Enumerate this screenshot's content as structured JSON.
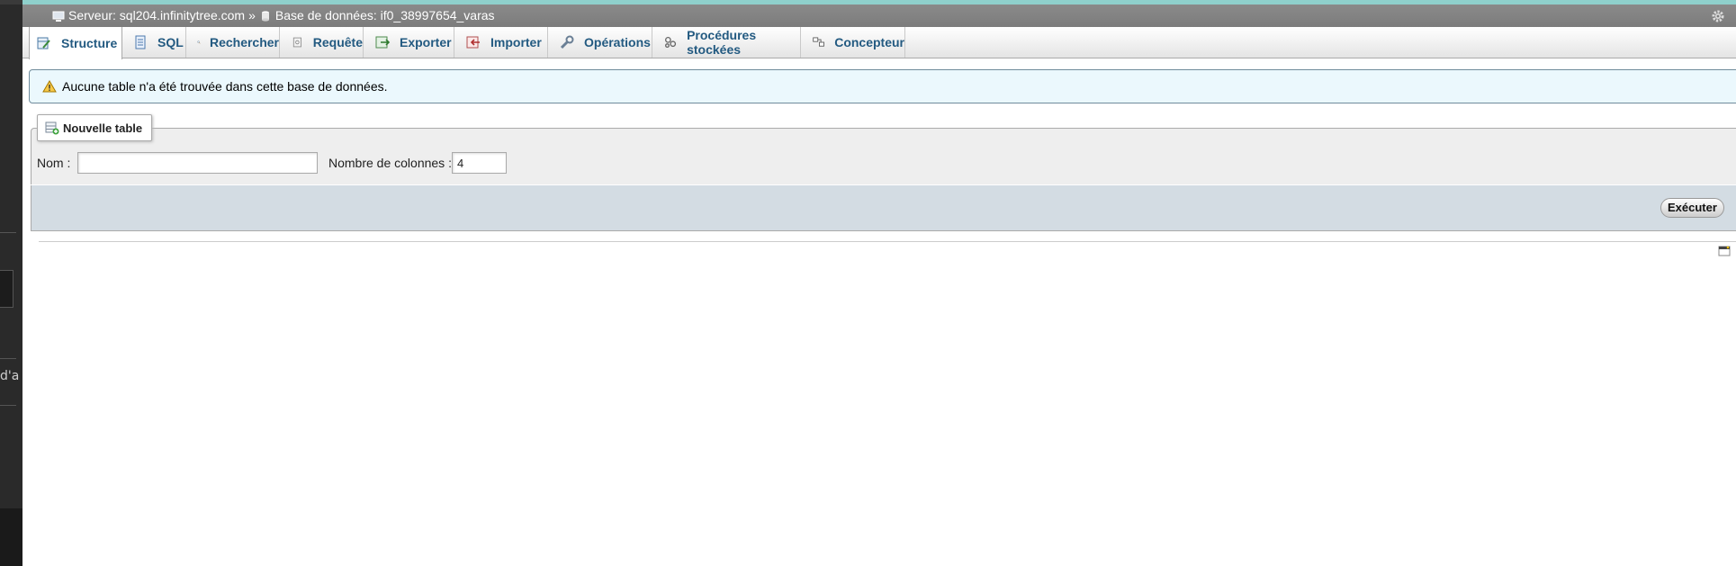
{
  "breadcrumb": {
    "server_label": "Serveur: sql204.infinitytree.com",
    "separator": "»",
    "database_label": "Base de données: if0_38997654_varas"
  },
  "tabs": [
    {
      "label": "Structure",
      "icon": "structure-icon",
      "active": true
    },
    {
      "label": "SQL",
      "icon": "sql-icon"
    },
    {
      "label": "Rechercher",
      "icon": "search-icon"
    },
    {
      "label": "Requête",
      "icon": "query-icon"
    },
    {
      "label": "Exporter",
      "icon": "export-icon"
    },
    {
      "label": "Importer",
      "icon": "import-icon"
    },
    {
      "label": "Opérations",
      "icon": "wrench-icon"
    },
    {
      "label": "Procédures stockées",
      "icon": "routines-icon"
    },
    {
      "label": "Concepteur",
      "icon": "designer-icon"
    }
  ],
  "notice": {
    "text": "Aucune table n'a été trouvée dans cette base de données."
  },
  "create_table": {
    "legend": "Nouvelle table",
    "name_label": "Nom :",
    "name_value": "",
    "columns_label": "Nombre de colonnes :",
    "columns_value": "4",
    "submit_label": "Exécuter"
  },
  "left_panel": {
    "partial_text": "d'a"
  }
}
